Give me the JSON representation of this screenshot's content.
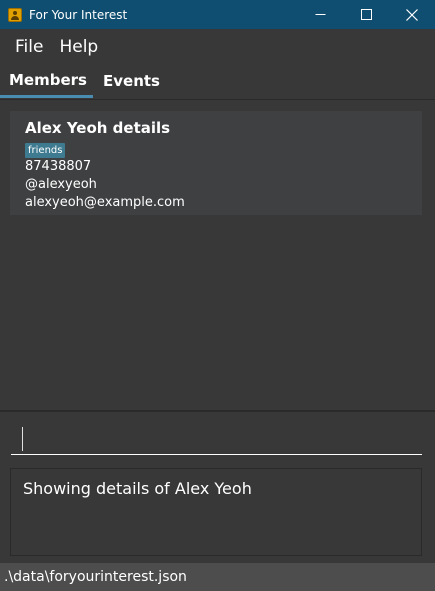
{
  "window": {
    "title": "For Your Interest",
    "controls": [
      "minimize-icon",
      "maximize-icon",
      "close-icon"
    ],
    "title_bar_color": "#0f4e70"
  },
  "menu": {
    "items": [
      {
        "label": "File"
      },
      {
        "label": "Help"
      }
    ]
  },
  "tabs": [
    {
      "label": "Members",
      "selected": true
    },
    {
      "label": "Events",
      "selected": false
    }
  ],
  "member_card": {
    "name": "Alex Yeoh details",
    "tag": "friends",
    "phone": "87438807",
    "handle": "@alexyeoh",
    "email": "alexyeoh@example.com"
  },
  "command": {
    "value": "",
    "placeholder": ""
  },
  "result": {
    "text": "Showing details of Alex Yeoh"
  },
  "status": {
    "path": ".\\data\\foryourinterest.json"
  },
  "colors": {
    "background": "#383838",
    "tag": "#3e7b91",
    "tab_underline": "#4a8bb0"
  }
}
